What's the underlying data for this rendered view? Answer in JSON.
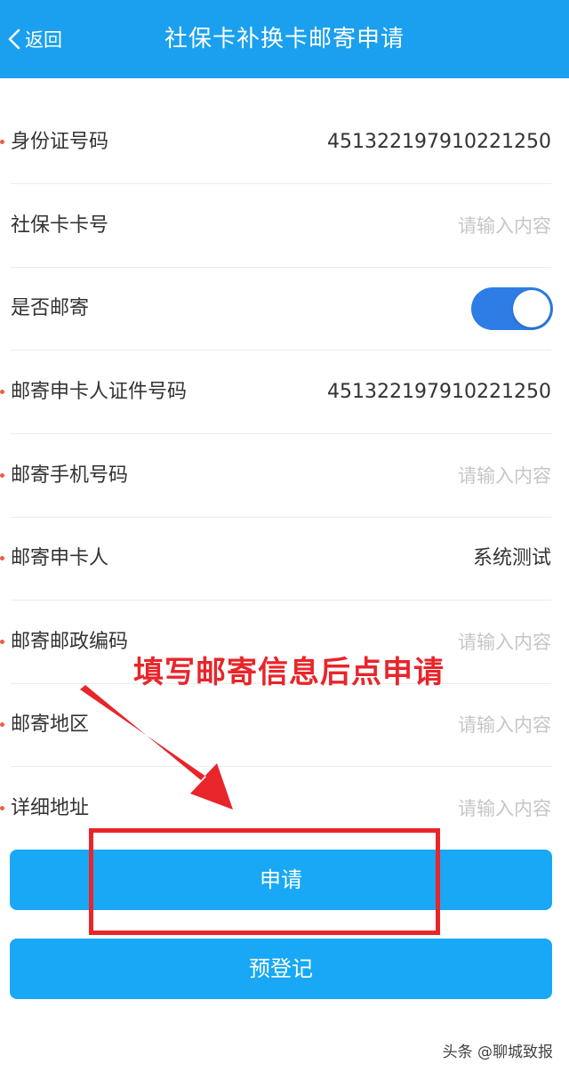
{
  "header": {
    "back_label": "返回",
    "title": "社保卡补换卡邮寄申请"
  },
  "form": {
    "rows": [
      {
        "label": "身份证号码",
        "required": true,
        "value": "451322197910221250",
        "placeholder": ""
      },
      {
        "label": "社保卡卡号",
        "required": false,
        "value": "",
        "placeholder": "请输入内容"
      },
      {
        "label": "是否邮寄",
        "required": false,
        "toggle": true
      },
      {
        "label": "邮寄申卡人证件号码",
        "required": true,
        "value": "451322197910221250",
        "placeholder": ""
      },
      {
        "label": "邮寄手机号码",
        "required": true,
        "value": "",
        "placeholder": "请输入内容"
      },
      {
        "label": "邮寄申卡人",
        "required": true,
        "value": "系统测试",
        "placeholder": ""
      },
      {
        "label": "邮寄邮政编码",
        "required": true,
        "value": "",
        "placeholder": "请输入内容"
      },
      {
        "label": "邮寄地区",
        "required": true,
        "value": "",
        "placeholder": "请输入内容"
      },
      {
        "label": "详细地址",
        "required": true,
        "value": "",
        "placeholder": "请输入内容"
      }
    ]
  },
  "buttons": {
    "apply_label": "申请",
    "preregister_label": "预登记"
  },
  "annotation": {
    "text": "填写邮寄信息后点申请"
  },
  "watermark": "头条 @聊城致报",
  "colors": {
    "header_bg": "#1aa0ee",
    "button_bg": "#18a8f5",
    "toggle_on": "#2e7de6",
    "required_dot": "#e8604a",
    "annotation_red": "#e8252a"
  }
}
